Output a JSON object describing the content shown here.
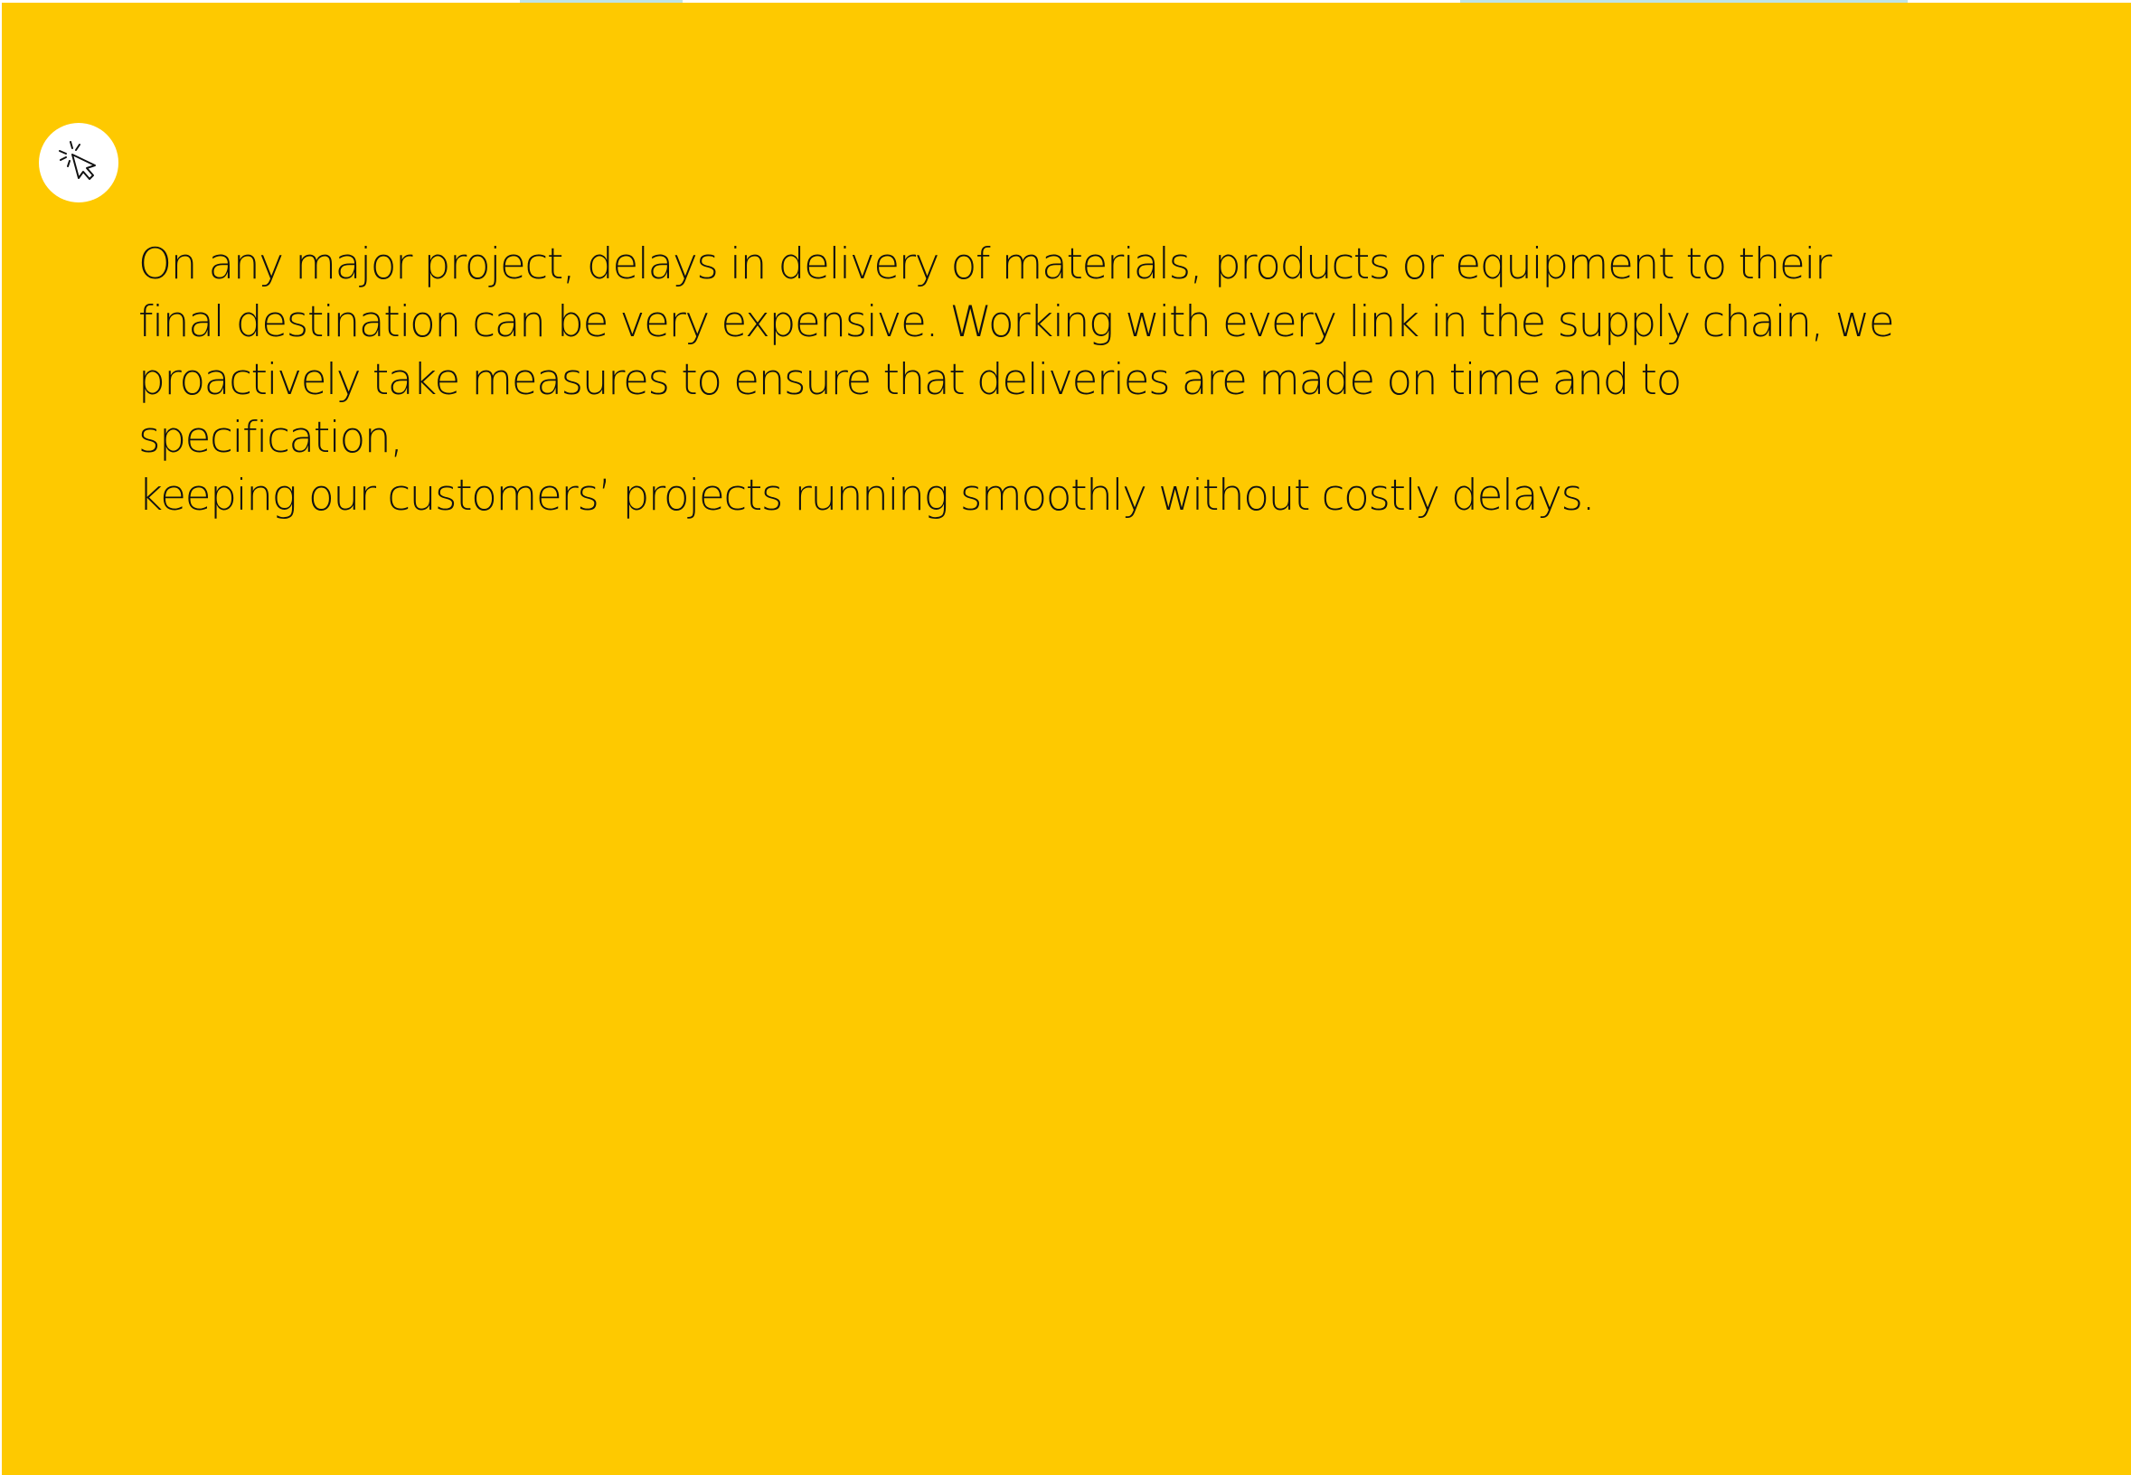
{
  "overlay": {
    "background_color": "#FEC900",
    "icon": "click-cursor-icon",
    "description_lines": [
      "On any major project, delays in delivery of materials, products or equipment to their",
      "final destination can be very expensive. Working with every link in the supply chain, we",
      "proactively take measures to ensure that deliveries are made on time and to specification,",
      "keeping our customers’ projects running smoothly without costly delays."
    ]
  }
}
